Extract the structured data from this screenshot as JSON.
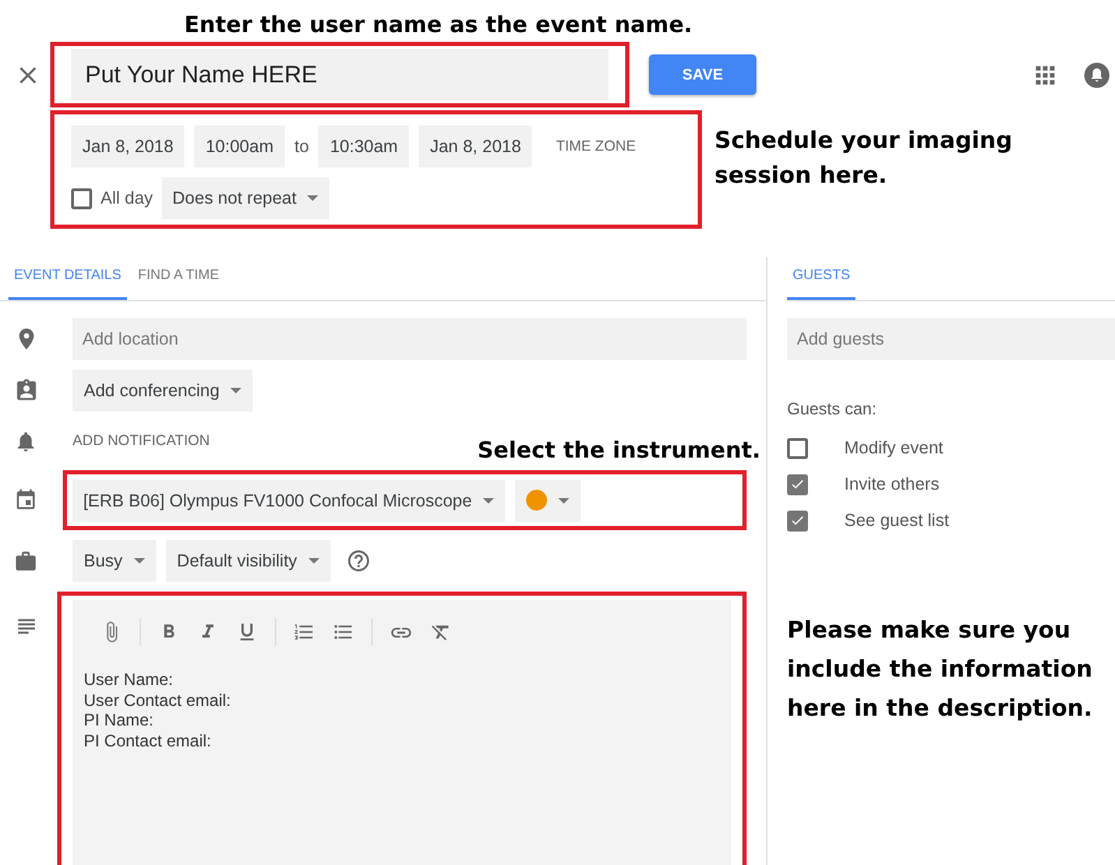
{
  "instructions": {
    "title_hint": "Enter the user name as the event name.",
    "schedule_hint": "Schedule your imaging session here.",
    "instrument_hint": "Select the instrument.",
    "description_hint": "Please make sure you include the information here in the description."
  },
  "header": {
    "title": {
      "value": "Put Your Name HERE"
    },
    "save_button": "SAVE"
  },
  "schedule": {
    "start_date": "Jan 8, 2018",
    "start_time": "10:00am",
    "separator": "to",
    "end_time": "10:30am",
    "end_date": "Jan 8, 2018",
    "time_zone": "TIME ZONE",
    "all_day": {
      "label": "All day",
      "checked": false
    },
    "repeat": "Does not repeat"
  },
  "tabs": [
    {
      "label": "EVENT DETAILS",
      "selected": true
    },
    {
      "label": "FIND A TIME",
      "selected": false
    }
  ],
  "details": {
    "location": {
      "placeholder": "Add location"
    },
    "conferencing": "Add conferencing",
    "notification": "ADD NOTIFICATION",
    "calendar": "[ERB B06] Olympus FV1000 Confocal Microscope",
    "color_picker": {
      "color": "#f09300"
    },
    "availability": "Busy",
    "visibility": "Default visibility",
    "description_lines": [
      "User Name:",
      "User Contact email:",
      "PI Name:",
      "PI Contact email:"
    ]
  },
  "guests": {
    "tab": {
      "label": "GUESTS",
      "selected": true
    },
    "field": {
      "placeholder": "Add guests"
    },
    "permissions_title": "Guests can:",
    "permissions": [
      {
        "label": "Modify event",
        "checked": false
      },
      {
        "label": "Invite others",
        "checked": true
      },
      {
        "label": "See guest list",
        "checked": true
      }
    ]
  }
}
